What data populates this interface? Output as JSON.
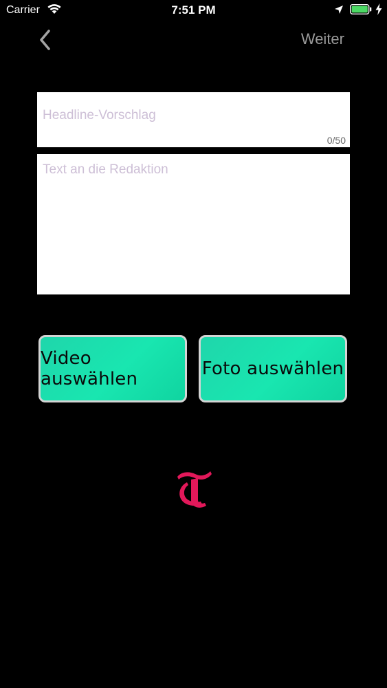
{
  "status_bar": {
    "carrier": "Carrier",
    "time": "7:51 PM",
    "icons": [
      "wifi-icon",
      "location-icon",
      "battery-icon",
      "charging-icon"
    ],
    "battery_color": "#4cd964"
  },
  "nav": {
    "back_icon": "chevron-left-icon",
    "next_label": "Weiter",
    "next_color": "#9a9a9a"
  },
  "form": {
    "headline_placeholder": "Headline-Vorschlag",
    "headline_value": "",
    "headline_counter": "0/50",
    "text_placeholder": "Text an die Redaktion",
    "text_value": ""
  },
  "buttons": {
    "video_label": "Video auswählen",
    "photo_label": "Foto auswählen",
    "accent_color": "#19e6b0"
  },
  "logo": {
    "icon": "tagesanzeiger-t-logo",
    "color": "#e2185a"
  }
}
